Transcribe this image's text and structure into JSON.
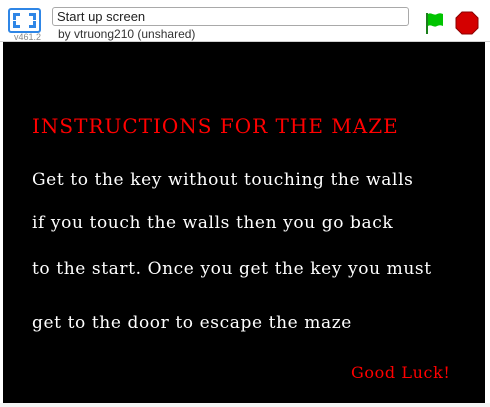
{
  "topbar": {
    "version": "v461.2",
    "title_value": "Start up screen",
    "author": "by vtruong210 (unshared)"
  },
  "controls": {
    "flag_icon": "green-flag-icon",
    "stop_icon": "stop-sign-icon",
    "fullscreen_icon": "fullscreen-icon",
    "flag_color": "#00c400",
    "stop_color": "#d40000",
    "fullscreen_color": "#2f86e6"
  },
  "stage": {
    "background": "#000000",
    "heading": "INSTRUCTIONS FOR THE MAZE",
    "lines": [
      "Get to the key without touching the walls",
      "if you touch the walls then you go back",
      "to the start. Once you get the key you must",
      "get to the door to escape the maze"
    ],
    "signoff": "Good Luck!",
    "heading_color": "#ff0000",
    "text_color": "#ffffff"
  }
}
